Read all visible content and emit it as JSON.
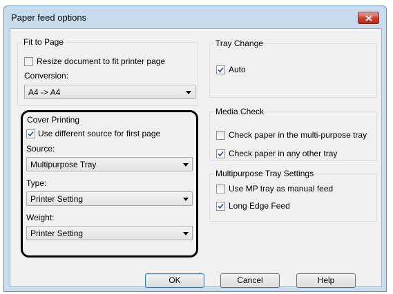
{
  "window": {
    "title": "Paper feed options"
  },
  "fit_to_page": {
    "title": "Fit to Page",
    "resize_label": "Resize document to fit printer page",
    "resize_checked": false,
    "conversion_label": "Conversion:",
    "conversion_value": "A4 -> A4"
  },
  "cover_printing": {
    "title": "Cover Printing",
    "use_diff_label": "Use different source for first page",
    "use_diff_checked": true,
    "source_label": "Source:",
    "source_value": "Multipurpose Tray",
    "type_label": "Type:",
    "type_value": "Printer Setting",
    "weight_label": "Weight:",
    "weight_value": "Printer Setting"
  },
  "tray_change": {
    "title": "Tray Change",
    "auto_label": "Auto",
    "auto_checked": true
  },
  "media_check": {
    "title": "Media Check",
    "mp_tray_label": "Check paper in the multi-purpose tray",
    "mp_tray_checked": false,
    "other_tray_label": "Check paper in any other tray",
    "other_tray_checked": true
  },
  "mp_tray_settings": {
    "title": "Multipurpose Tray Settings",
    "manual_feed_label": "Use MP tray as manual feed",
    "manual_feed_checked": false,
    "long_edge_label": "Long Edge Feed",
    "long_edge_checked": true
  },
  "buttons": {
    "ok": "OK",
    "cancel": "Cancel",
    "help": "Help"
  }
}
